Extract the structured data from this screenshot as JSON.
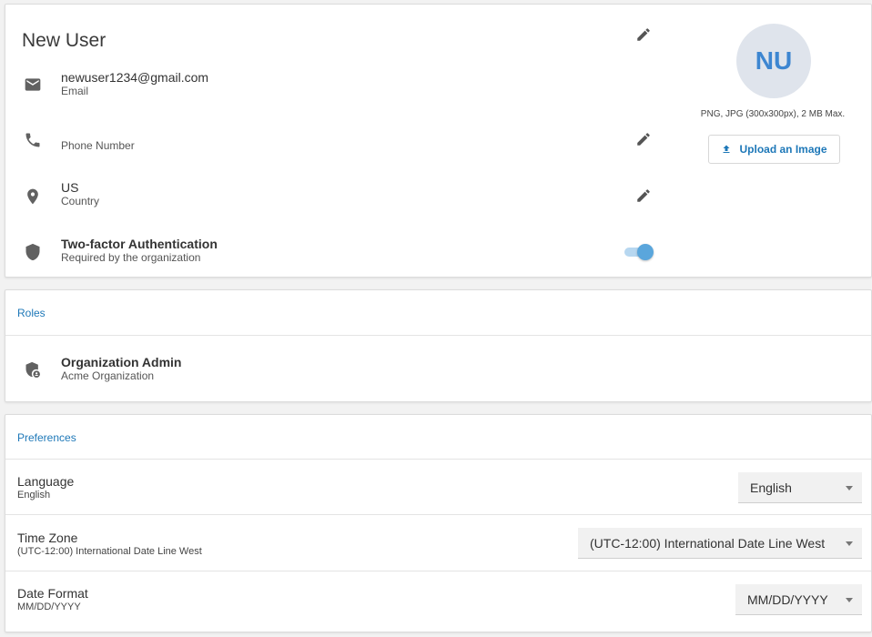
{
  "profile": {
    "name": "New User",
    "email": {
      "value": "newuser1234@gmail.com",
      "label": "Email"
    },
    "phone": {
      "value": "",
      "label": "Phone Number"
    },
    "country": {
      "value": "US",
      "label": "Country"
    },
    "two_factor": {
      "title": "Two-factor Authentication",
      "subtitle": "Required by the organization",
      "enabled": true
    },
    "avatar_initials": "NU",
    "upload_hint": "PNG, JPG (300x300px), 2 MB Max.",
    "upload_label": "Upload an Image",
    "icons": {
      "email": "mail-icon",
      "phone": "phone-icon",
      "country": "location-pin-icon",
      "two_factor": "shield-icon",
      "edit": "pencil-icon",
      "upload": "upload-icon"
    },
    "accent_color": "#1e78b8",
    "toggle_color": "#5aa6dc"
  },
  "roles": {
    "title": "Roles",
    "items": [
      {
        "name": "Organization Admin",
        "org": "Acme Organization",
        "icon": "shield-user-icon"
      }
    ]
  },
  "preferences": {
    "title": "Preferences",
    "language": {
      "label": "Language",
      "value": "English",
      "selected": "English"
    },
    "timezone": {
      "label": "Time Zone",
      "value": "(UTC-12:00) International Date Line West",
      "selected": "(UTC-12:00) International Date Line West"
    },
    "date_format": {
      "label": "Date Format",
      "value": "MM/DD/YYYY",
      "selected": "MM/DD/YYYY"
    }
  }
}
